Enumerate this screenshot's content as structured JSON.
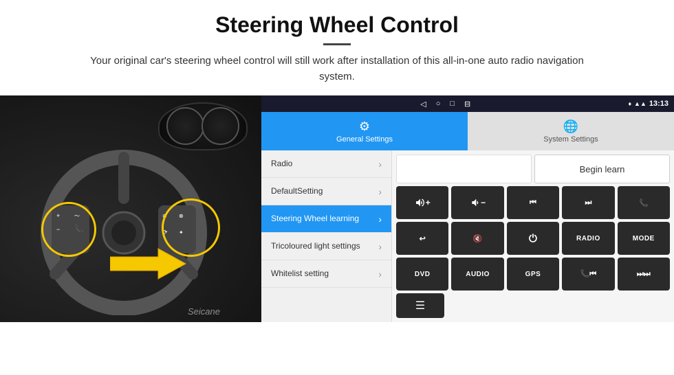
{
  "header": {
    "title": "Steering Wheel Control",
    "subtitle": "Your original car's steering wheel control will still work after installation of this all-in-one auto radio navigation system."
  },
  "status_bar": {
    "time": "13:13",
    "nav_icons": [
      "◁",
      "○",
      "□",
      "⊟"
    ]
  },
  "tabs": [
    {
      "id": "general",
      "label": "General Settings",
      "active": true
    },
    {
      "id": "system",
      "label": "System Settings",
      "active": false
    }
  ],
  "menu_items": [
    {
      "id": "radio",
      "label": "Radio",
      "active": false
    },
    {
      "id": "default",
      "label": "DefaultSetting",
      "active": false
    },
    {
      "id": "steering",
      "label": "Steering Wheel learning",
      "active": true
    },
    {
      "id": "tricoloured",
      "label": "Tricoloured light settings",
      "active": false
    },
    {
      "id": "whitelist",
      "label": "Whitelist setting",
      "active": false
    }
  ],
  "begin_learn_label": "Begin learn",
  "control_buttons": [
    {
      "id": "vol_up",
      "icon": "🔊+",
      "type": "icon"
    },
    {
      "id": "vol_down",
      "icon": "🔉-",
      "type": "icon"
    },
    {
      "id": "prev_track",
      "icon": "⏮",
      "type": "icon"
    },
    {
      "id": "next_track",
      "icon": "⏭",
      "type": "icon"
    },
    {
      "id": "phone",
      "icon": "📞",
      "type": "icon"
    },
    {
      "id": "back",
      "icon": "↩",
      "type": "icon"
    },
    {
      "id": "mute",
      "icon": "🔇",
      "type": "icon"
    },
    {
      "id": "power",
      "icon": "⏻",
      "type": "icon"
    },
    {
      "id": "radio_btn",
      "label": "RADIO",
      "type": "text"
    },
    {
      "id": "mode",
      "label": "MODE",
      "type": "text"
    },
    {
      "id": "dvd",
      "label": "DVD",
      "type": "text"
    },
    {
      "id": "audio",
      "label": "AUDIO",
      "type": "text"
    },
    {
      "id": "gps",
      "label": "GPS",
      "type": "text"
    },
    {
      "id": "phone2",
      "icon": "📞⏮",
      "type": "icon"
    },
    {
      "id": "skip",
      "icon": "⏭",
      "type": "icon"
    }
  ],
  "watermark": "Seicane"
}
